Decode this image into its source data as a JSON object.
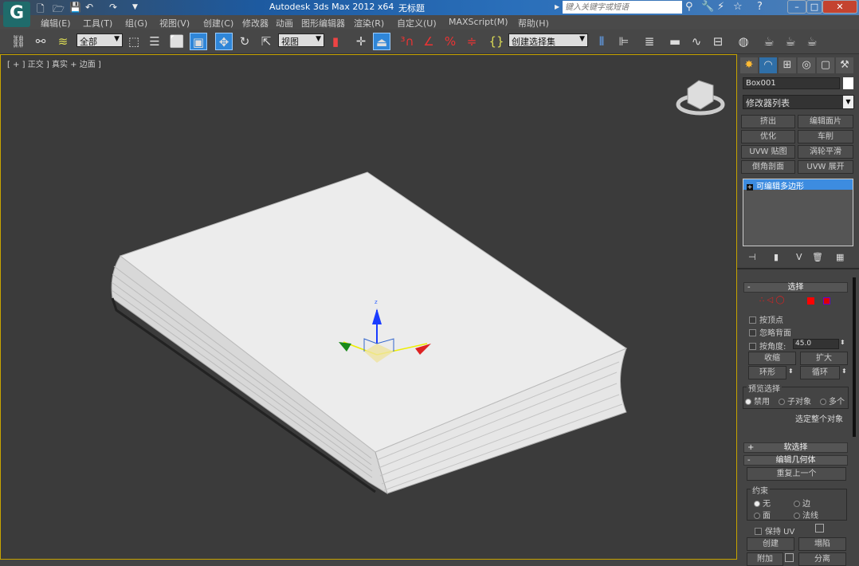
{
  "titlebar": {
    "app_title": "Autodesk 3ds Max  2012 x64",
    "doc_title": "无标题",
    "search_placeholder": "键入关键字或短语",
    "logo": "G"
  },
  "menus": [
    "编辑(E)",
    "工具(T)",
    "组(G)",
    "视图(V)",
    "创建(C)",
    "修改器",
    "动画",
    "图形编辑器",
    "渲染(R)",
    "自定义(U)",
    "MAXScript(M)",
    "帮助(H)"
  ],
  "toolbar": {
    "selection_filter": "全部",
    "ref_coord": "视图",
    "named_selection": "创建选择集"
  },
  "viewport": {
    "label": "[ + ] 正交 ] 真实 + 边面 ]",
    "gizmo_axis": "z",
    "accent": "#c8a400"
  },
  "panel": {
    "object_name": "Box001",
    "modifier_list": "修改器列表",
    "modifier_buttons": [
      "挤出",
      "编辑面片",
      "优化",
      "车削",
      "UVW 贴图",
      "涡轮平滑",
      "倒角剖面",
      "UVW 展开"
    ],
    "stack_items": [
      "可编辑多边形"
    ],
    "selection": {
      "title": "选择",
      "checkboxes": [
        "按顶点",
        "忽略背面",
        "按角度:"
      ],
      "angle_value": "45.0",
      "shrink": "收缩",
      "grow": "扩大",
      "ring": "环形",
      "loop": "循环",
      "preview_title": "预览选择",
      "preview_options": [
        "禁用",
        "子对象",
        "多个"
      ],
      "select_whole": "选定整个对象"
    },
    "soft_selection": {
      "title": "软选择"
    },
    "edit_geometry": {
      "title": "编辑几何体",
      "repeat_last": "重复上一个",
      "constraints_title": "约束",
      "constraints": [
        "无",
        "边",
        "面",
        "法线"
      ],
      "preserve_uv": "保持 UV",
      "create": "创建",
      "collapse": "塌陷",
      "attach": "附加",
      "detach": "分离"
    }
  }
}
